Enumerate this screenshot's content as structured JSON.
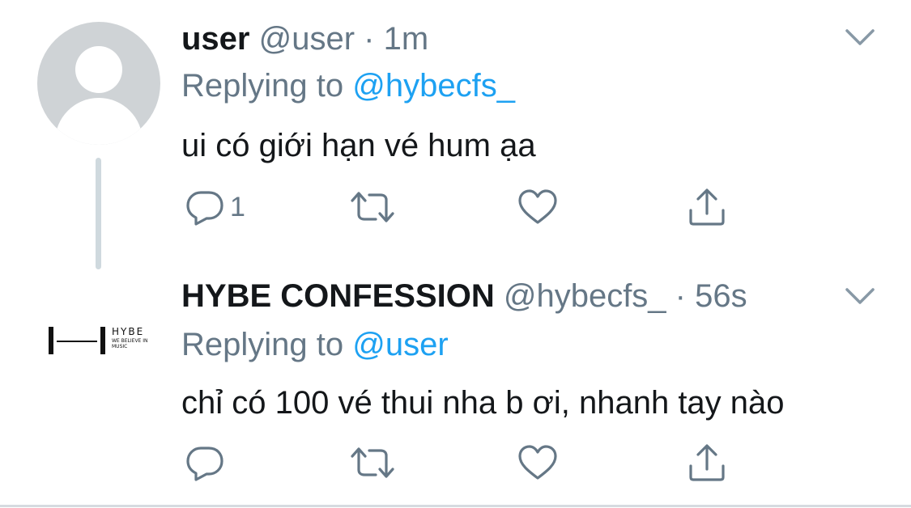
{
  "tweets": [
    {
      "display_name": "user",
      "handle": "@user",
      "separator": "·",
      "time": "1m",
      "replying_prefix": "Replying to",
      "replying_to": "@hybecfs_",
      "text": "ui có giới hạn vé hum ạa",
      "reply_count": "1",
      "avatar_icon": "default-profile-icon"
    },
    {
      "display_name": "HYBE CONFESSION",
      "handle": "@hybecfs_",
      "separator": "·",
      "time": "56s",
      "replying_prefix": "Replying to",
      "replying_to": "@user",
      "text": "chỉ có 100 vé thui nha b ơi, nhanh tay nào",
      "reply_count": "",
      "avatar_logo": {
        "brand": "HYBE",
        "tagline": "WE BELIEVE IN MUSIC"
      }
    }
  ],
  "icons": {
    "reply": "reply-icon",
    "retweet": "retweet-icon",
    "like": "heart-icon",
    "share": "share-icon",
    "menu": "chevron-down-icon"
  },
  "colors": {
    "link": "#1da1f2",
    "secondary_text": "#657786",
    "primary_text": "#14171a",
    "icon": "#657786",
    "thread_line": "#cfd9de"
  }
}
